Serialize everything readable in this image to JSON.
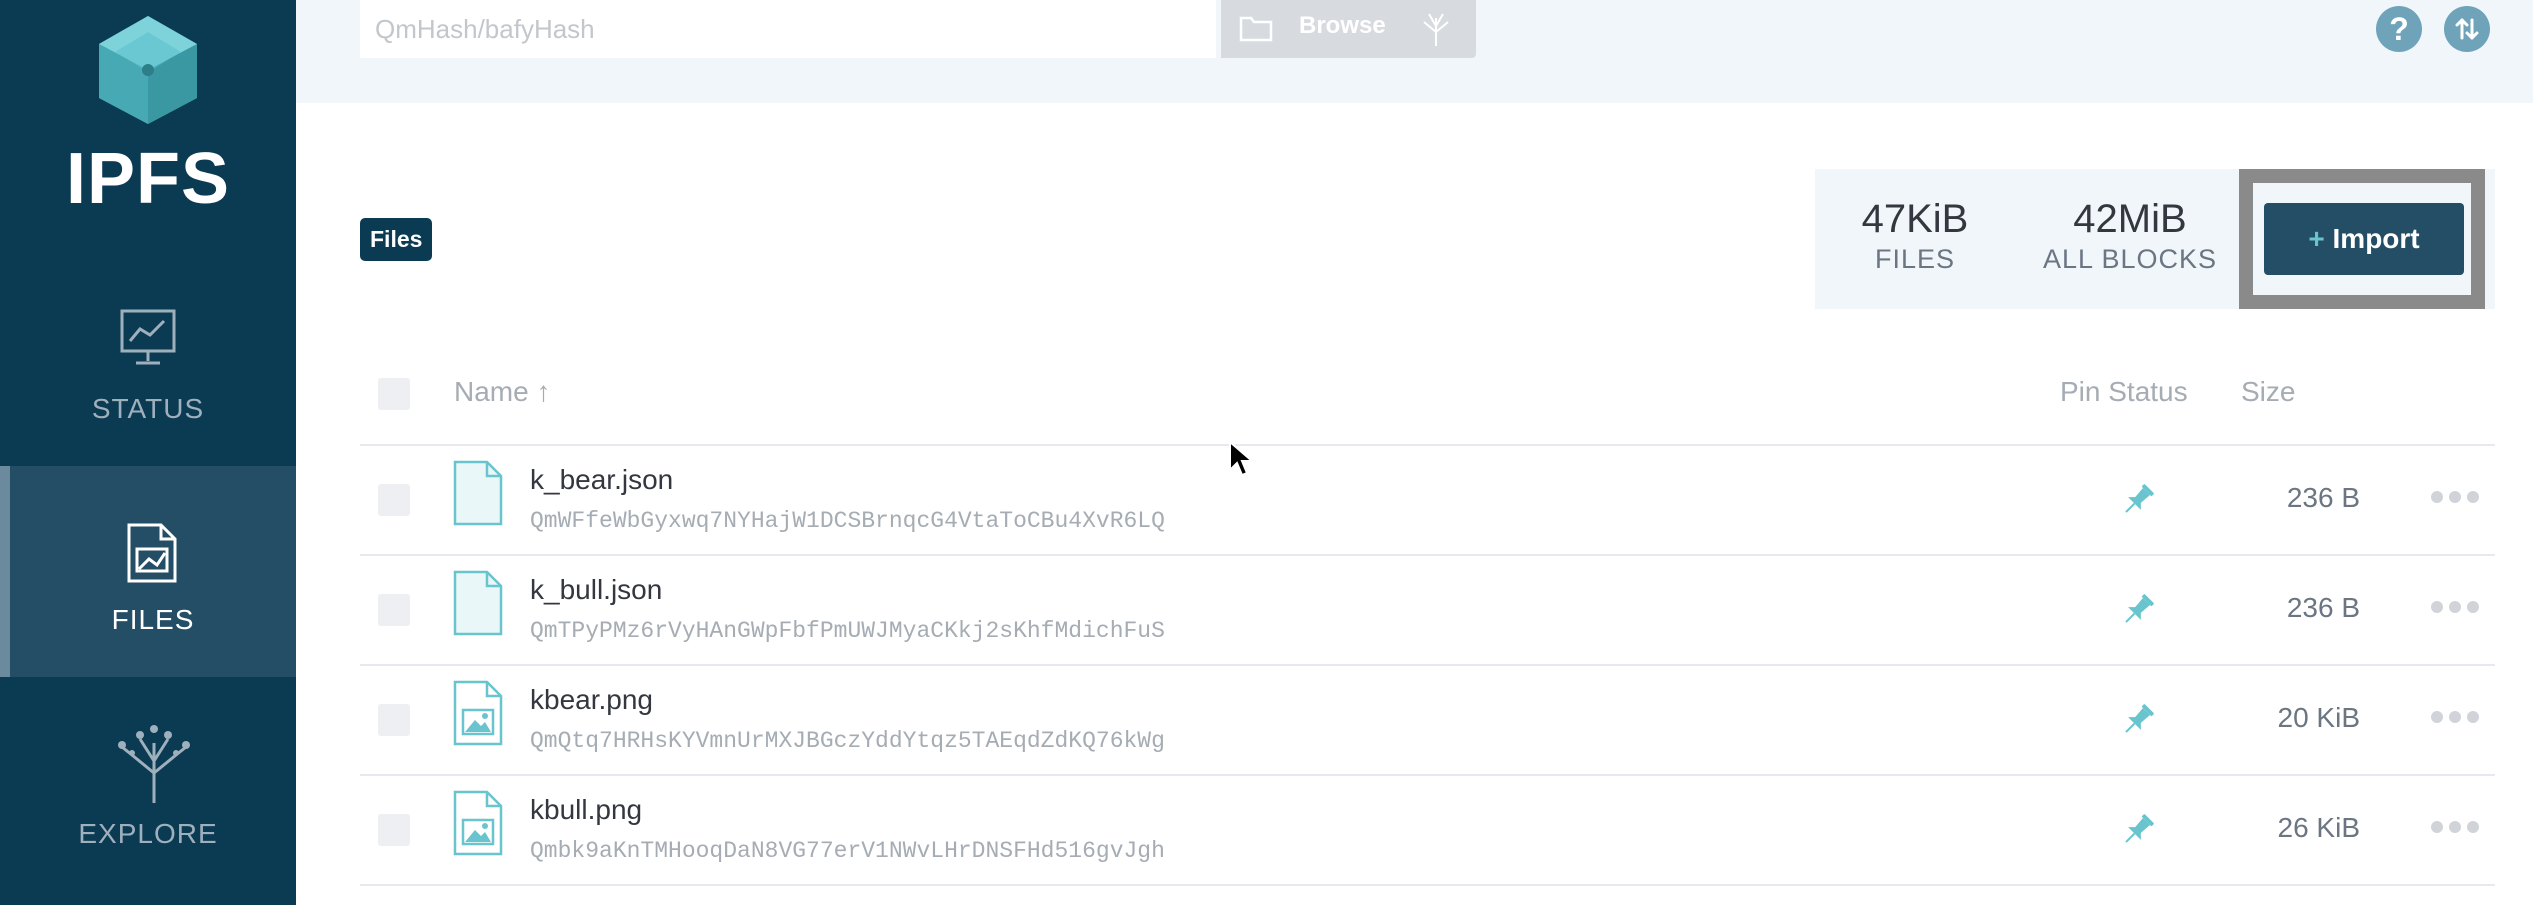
{
  "app": {
    "logo_text": "IPFS"
  },
  "sidebar": {
    "items": [
      {
        "label": "STATUS",
        "icon": "status-chart-icon",
        "active": false
      },
      {
        "label": "FILES",
        "icon": "files-doc-icon",
        "active": true
      },
      {
        "label": "EXPLORE",
        "icon": "tree-icon",
        "active": false
      }
    ]
  },
  "header": {
    "search": {
      "placeholder": "QmHash/bafyHash",
      "value": ""
    },
    "browse_label": "Browse",
    "help_icon": "?"
  },
  "toolbar": {
    "breadcrumb": "Files",
    "stats": [
      {
        "value": "47KiB",
        "label": "FILES"
      },
      {
        "value": "42MiB",
        "label": "ALL BLOCKS"
      }
    ],
    "import_plus": "+",
    "import_label": "Import"
  },
  "table": {
    "columns": {
      "name": "Name ↑",
      "pin_status": "Pin Status",
      "size": "Size"
    },
    "rows": [
      {
        "name": "k_bear.json",
        "hash": "QmWFfeWbGyxwq7NYHajW1DCSBrnqcG4VtaToCBu4XvR6LQ",
        "size": "236 B",
        "type": "document"
      },
      {
        "name": "k_bull.json",
        "hash": "QmTPyPMz6rVyHAnGWpFbfPmUWJMyaCKkj2sKhfMdichFuS",
        "size": "236 B",
        "type": "document"
      },
      {
        "name": "kbear.png",
        "hash": "QmQtq7HRHsKYVmnUrMXJBGczYddYtqz5TAEqdZdKQ76kWg",
        "size": "20 KiB",
        "type": "image"
      },
      {
        "name": "kbull.png",
        "hash": "Qmbk9aKnTMHooqDaN8VG77erV1NWvLHrDNSFHd516gvJgh",
        "size": "26 KiB",
        "type": "image"
      }
    ]
  },
  "colors": {
    "sidebar_bg": "#0b3a53",
    "sidebar_active": "#244e66",
    "accent_teal": "#69c4cd",
    "header_bg": "#f0f6fa"
  }
}
